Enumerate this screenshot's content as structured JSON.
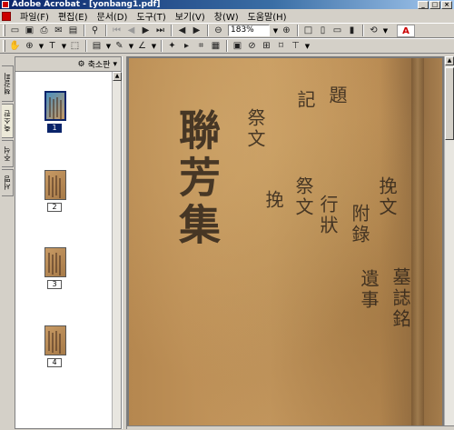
{
  "window": {
    "title": "Adobe Acrobat - [yonbang1.pdf]",
    "min": "_",
    "max": "□",
    "close": "×"
  },
  "menu": [
    "파일(F)",
    "편집(E)",
    "문서(D)",
    "도구(T)",
    "보기(V)",
    "창(W)",
    "도움말(H)"
  ],
  "toolbar": {
    "zoom_value": "183%",
    "adobe_logo": "A"
  },
  "nav_tabs": [
    "책갈피",
    "축소판",
    "주석",
    "서명"
  ],
  "nav_panel": {
    "header_label": "축소판",
    "header_menu": "▾"
  },
  "thumbnails": [
    {
      "label": "1",
      "selected": true
    },
    {
      "label": "2",
      "selected": false
    },
    {
      "label": "3",
      "selected": false
    },
    {
      "label": "4",
      "selected": false
    }
  ],
  "document": {
    "calligraphy_large": "聯芳集",
    "calligraphy_columns": [
      "挽文",
      "附錄",
      "墓誌銘",
      "遺事",
      "行狀",
      "祭文",
      "挽",
      "祭文",
      "記",
      "題"
    ]
  },
  "icons": [
    "open-icon",
    "save-icon",
    "print-icon",
    "email-icon",
    "search-icon",
    "hand-icon",
    "zoom-in-icon",
    "zoom-out-icon",
    "text-select-icon",
    "first-page-icon",
    "prev-page-icon",
    "next-page-icon",
    "last-page-icon",
    "back-icon",
    "forward-icon",
    "zoom-out-button-icon",
    "zoom-in-button-icon"
  ]
}
